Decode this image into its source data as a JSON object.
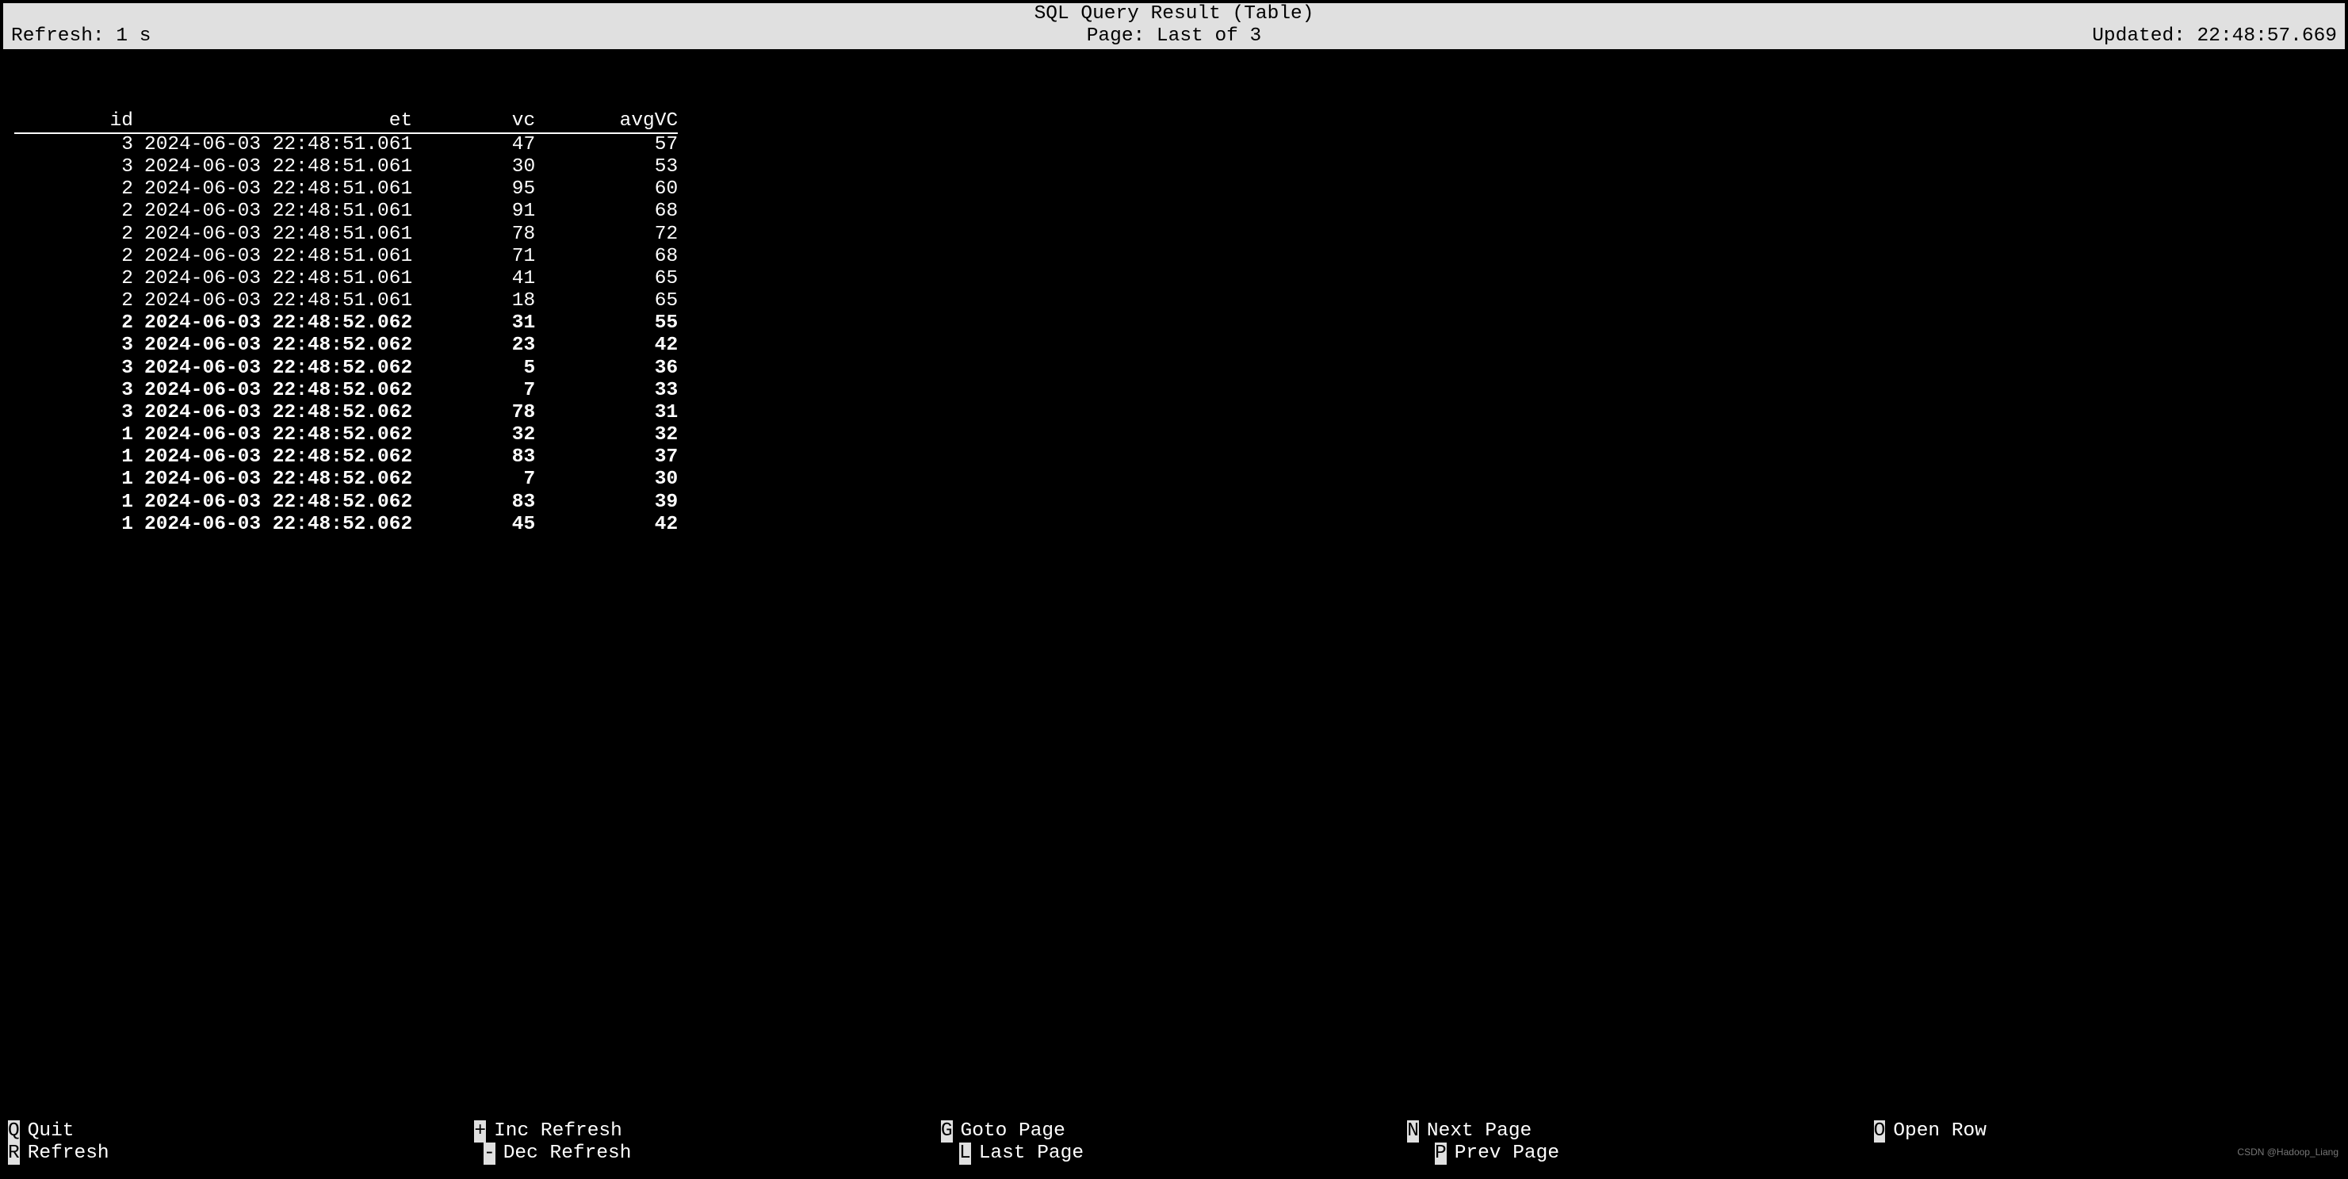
{
  "header": {
    "title": "SQL Query Result (Table)",
    "refresh_label": "Refresh: 1 s",
    "page_label": "Page: Last of 3",
    "updated_label": "Updated: 22:48:57.669"
  },
  "columns": {
    "c0": "id",
    "c1": "et",
    "c2": "vc",
    "c3": "avgVC"
  },
  "rows": [
    {
      "id": "3",
      "et": "2024-06-03 22:48:51.061",
      "vc": "47",
      "avgvc": "57",
      "bold": false
    },
    {
      "id": "3",
      "et": "2024-06-03 22:48:51.061",
      "vc": "30",
      "avgvc": "53",
      "bold": false
    },
    {
      "id": "2",
      "et": "2024-06-03 22:48:51.061",
      "vc": "95",
      "avgvc": "60",
      "bold": false
    },
    {
      "id": "2",
      "et": "2024-06-03 22:48:51.061",
      "vc": "91",
      "avgvc": "68",
      "bold": false
    },
    {
      "id": "2",
      "et": "2024-06-03 22:48:51.061",
      "vc": "78",
      "avgvc": "72",
      "bold": false
    },
    {
      "id": "2",
      "et": "2024-06-03 22:48:51.061",
      "vc": "71",
      "avgvc": "68",
      "bold": false
    },
    {
      "id": "2",
      "et": "2024-06-03 22:48:51.061",
      "vc": "41",
      "avgvc": "65",
      "bold": false
    },
    {
      "id": "2",
      "et": "2024-06-03 22:48:51.061",
      "vc": "18",
      "avgvc": "65",
      "bold": false
    },
    {
      "id": "2",
      "et": "2024-06-03 22:48:52.062",
      "vc": "31",
      "avgvc": "55",
      "bold": true
    },
    {
      "id": "3",
      "et": "2024-06-03 22:48:52.062",
      "vc": "23",
      "avgvc": "42",
      "bold": true
    },
    {
      "id": "3",
      "et": "2024-06-03 22:48:52.062",
      "vc": "5",
      "avgvc": "36",
      "bold": true
    },
    {
      "id": "3",
      "et": "2024-06-03 22:48:52.062",
      "vc": "7",
      "avgvc": "33",
      "bold": true
    },
    {
      "id": "3",
      "et": "2024-06-03 22:48:52.062",
      "vc": "78",
      "avgvc": "31",
      "bold": true
    },
    {
      "id": "1",
      "et": "2024-06-03 22:48:52.062",
      "vc": "32",
      "avgvc": "32",
      "bold": true
    },
    {
      "id": "1",
      "et": "2024-06-03 22:48:52.062",
      "vc": "83",
      "avgvc": "37",
      "bold": true
    },
    {
      "id": "1",
      "et": "2024-06-03 22:48:52.062",
      "vc": "7",
      "avgvc": "30",
      "bold": true
    },
    {
      "id": "1",
      "et": "2024-06-03 22:48:52.062",
      "vc": "83",
      "avgvc": "39",
      "bold": true
    },
    {
      "id": "1",
      "et": "2024-06-03 22:48:52.062",
      "vc": "45",
      "avgvc": "42",
      "bold": true
    }
  ],
  "keys": {
    "row1": [
      {
        "key": "Q",
        "label": "Quit"
      },
      {
        "key": "+",
        "label": "Inc Refresh"
      },
      {
        "key": "G",
        "label": "Goto Page"
      },
      {
        "key": "N",
        "label": "Next Page"
      },
      {
        "key": "O",
        "label": "Open Row"
      }
    ],
    "row2": [
      {
        "key": "R",
        "label": "Refresh"
      },
      {
        "key": "-",
        "label": "Dec Refresh"
      },
      {
        "key": "L",
        "label": "Last Page"
      },
      {
        "key": "P",
        "label": "Prev Page"
      }
    ]
  },
  "watermark": "CSDN @Hadoop_Liang"
}
